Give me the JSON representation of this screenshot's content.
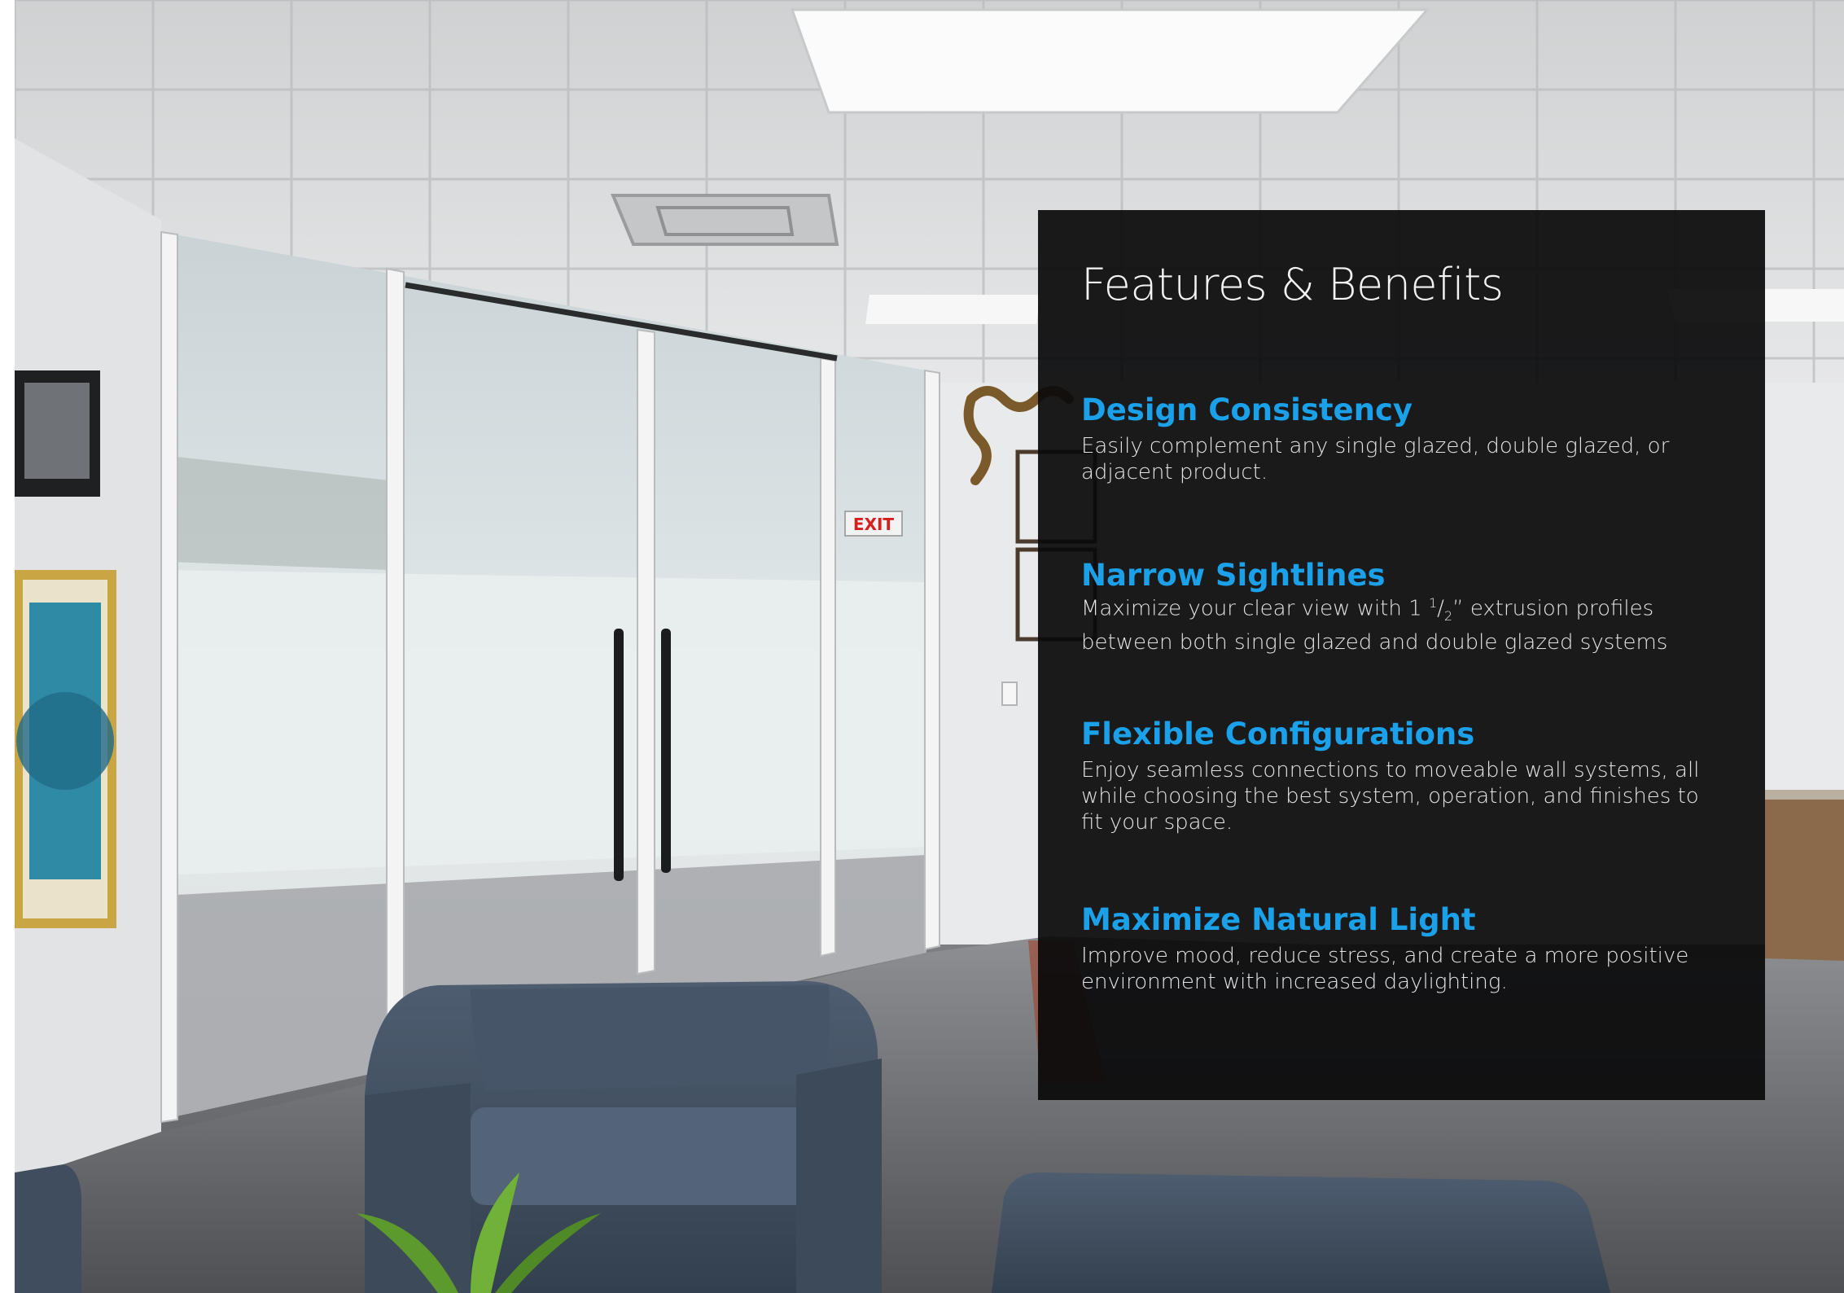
{
  "panel": {
    "title": "Features & Benefits",
    "features": [
      {
        "heading": "Design Consistency",
        "body": "Easily complement any single glazed, double glazed, or adjacent product."
      },
      {
        "heading": "Narrow Sightlines",
        "body_prefix": "Maximize your clear view with 1 ",
        "fraction_numerator": "1",
        "fraction_slash": "/",
        "fraction_denominator": "2",
        "body_suffix": "” extrusion profiles between both single glazed and double glazed systems"
      },
      {
        "heading": "Flexible Configurations",
        "body": "Enjoy seamless connections to moveable wall systems, all while choosing the best system, operation, and finishes to fit your space."
      },
      {
        "heading": "Maximize Natural Light",
        "body": "Improve mood, reduce stress, and create a more positive environment with increased daylighting."
      }
    ]
  },
  "photo": {
    "exit_sign": "EXIT"
  },
  "colors": {
    "panel_background": "#0a0a0b",
    "heading_accent": "#1ba0ea",
    "title_text": "#f3f3f3",
    "body_text": "#e4e4e4"
  }
}
